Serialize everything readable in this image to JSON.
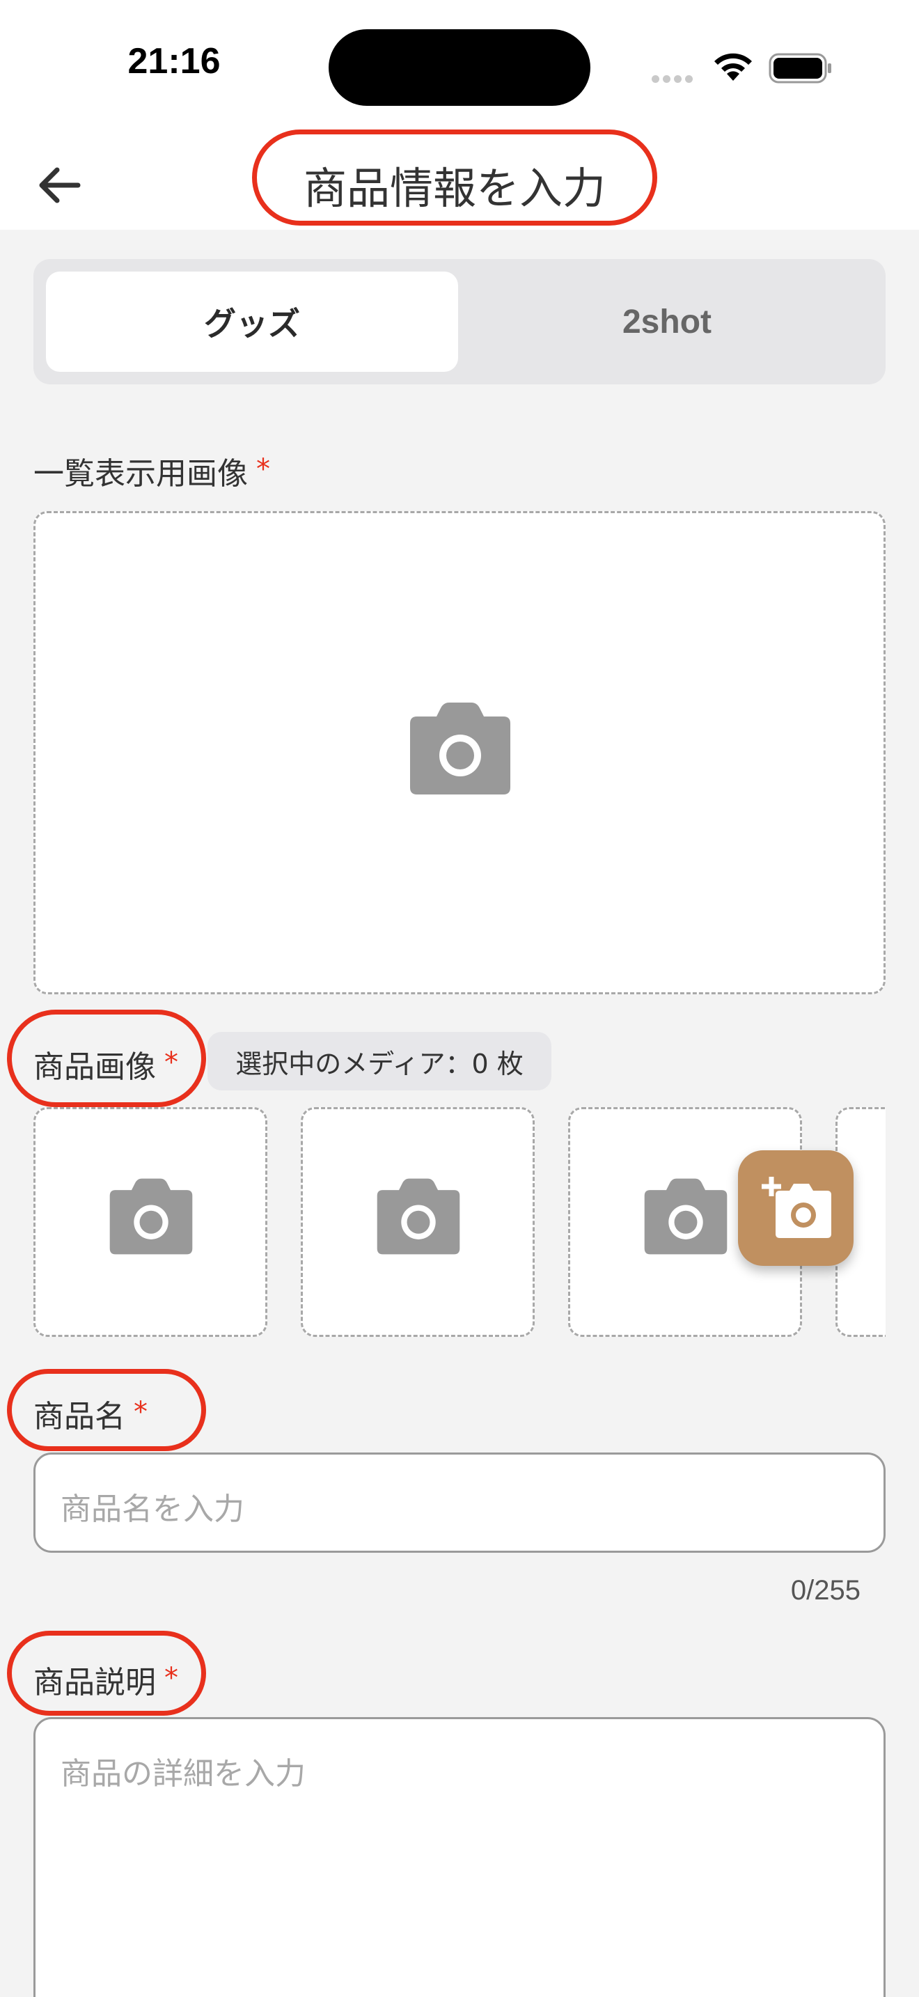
{
  "status_bar": {
    "time": "21:16"
  },
  "header": {
    "title": "商品情報を入力"
  },
  "tabs": [
    {
      "label": "グッズ",
      "active": true
    },
    {
      "label": "2shot",
      "active": false
    }
  ],
  "list_image": {
    "label": "一覧表示用画像",
    "required_mark": "*"
  },
  "product_images": {
    "label": "商品画像",
    "required_mark": "*",
    "selected_media": "選択中のメディア：0 枚"
  },
  "product_name": {
    "label": "商品名",
    "required_mark": "*",
    "placeholder": "商品名を入力",
    "value": "",
    "counter": "0/255"
  },
  "product_description": {
    "label": "商品説明",
    "required_mark": "*",
    "placeholder": "商品の詳細を入力",
    "value": ""
  },
  "colors": {
    "accent_red": "#e8301c",
    "fab_brown": "#c09060",
    "icon_gray": "#999999"
  },
  "icons": [
    "back-arrow-icon",
    "camera-icon",
    "add-photo-icon",
    "wifi-icon",
    "battery-icon"
  ]
}
